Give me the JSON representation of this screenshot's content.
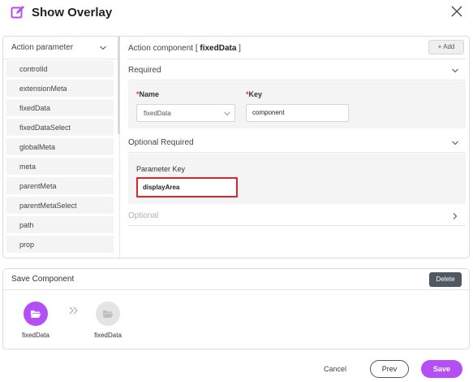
{
  "dialog": {
    "title": "Show Overlay",
    "accent_color": "#b44ef5",
    "title_icon": "edit-square-icon",
    "close_icon": "close-x-icon"
  },
  "sidebar": {
    "header_label": "Action parameter",
    "items": [
      {
        "label": "controlId"
      },
      {
        "label": "extensionMeta"
      },
      {
        "label": "fixedData"
      },
      {
        "label": "fixedDataSelect"
      },
      {
        "label": "globalMeta"
      },
      {
        "label": "meta"
      },
      {
        "label": "parentMeta"
      },
      {
        "label": "parentMetaSelect"
      },
      {
        "label": "path"
      },
      {
        "label": "prop"
      }
    ]
  },
  "main": {
    "header_prefix": "Action component [ ",
    "header_value": "fixedData",
    "header_suffix": " ]",
    "add_label": "+ Add",
    "required": {
      "label": "Required",
      "name_label": "Name",
      "name_value": "fixedData",
      "key_label": "Key",
      "key_value": "component",
      "required_mark": "*"
    },
    "optional_required": {
      "label": "Optional Required",
      "param_key_label": "Parameter Key",
      "param_key_value": "displayArea"
    },
    "optional": {
      "label": "Optional"
    }
  },
  "save_component": {
    "label": "Save Component",
    "delete_label": "Delete",
    "nodes": [
      {
        "label": "fixedData",
        "state": "active",
        "color": "#b44ef5"
      },
      {
        "label": "fixedData",
        "state": "inactive",
        "color": "#e4e4e4"
      }
    ]
  },
  "footer": {
    "cancel_label": "Cancel",
    "prev_label": "Prev",
    "save_label": "Save"
  }
}
